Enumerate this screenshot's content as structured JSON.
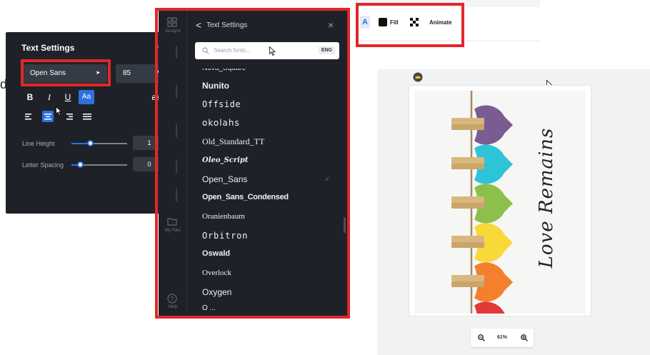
{
  "left_panel": {
    "title": "Text Settings",
    "close": "×",
    "font_name": "Open Sans",
    "font_caret": "▸",
    "font_size": "85",
    "size_caret": "▾",
    "bold": "B",
    "italic": "I",
    "underline": "U",
    "case": "Aa",
    "strike": "æ",
    "line_height_label": "Line Height",
    "line_height_value": "1",
    "letter_spacing_label": "Letter Spacing",
    "letter_spacing_value": "0",
    "line_height_level": 0.35,
    "letter_spacing_level": 0.1,
    "edge_letter": "d"
  },
  "font_panel": {
    "rail": [
      "Designs",
      "My Files",
      "Help"
    ],
    "header_title": "Text Settings",
    "back": "<",
    "close": "×",
    "search_placeholder": "Search fonts...",
    "lang": "ENG",
    "fonts": [
      "Nova_Square",
      "Nunito",
      "Offside",
      "okolahs",
      "Old_Standard_TT",
      "Oleo_Script",
      "Open_Sans",
      "Open_Sans_Condensed",
      "Oranienbaum",
      "Orbitron",
      "Oswald",
      "Overlock",
      "Oxygen",
      "O ..."
    ],
    "selected_font": "Open_Sans",
    "check": "✓"
  },
  "toolbar": {
    "text_icon": "A",
    "fill_label": "Fill",
    "animate_label": "Animate",
    "fill_color": "#111111"
  },
  "canvas": {
    "design_text": "Love Remains",
    "hearts": [
      "#7a5c93",
      "#2ec4d8",
      "#8cc04a",
      "#f9d83a",
      "#f47f2c",
      "#e23838"
    ],
    "zoom_value": "61%"
  },
  "accent": "#2f6fe0",
  "highlight": "#e3262a"
}
